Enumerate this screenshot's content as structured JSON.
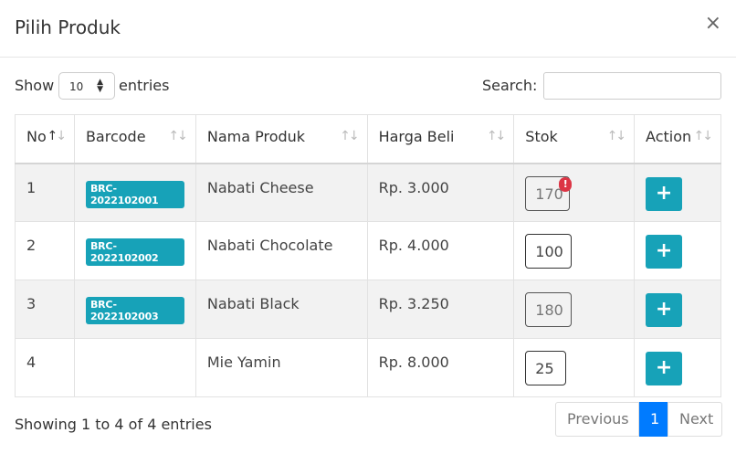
{
  "modal": {
    "title": "Pilih Produk",
    "close_glyph": "×"
  },
  "controls": {
    "show_label": "Show",
    "entries_value": "10",
    "entries_label": "entries",
    "search_label": "Search:",
    "search_value": ""
  },
  "table": {
    "headers": [
      "No",
      "Barcode",
      "Nama Produk",
      "Harga Beli",
      "Stok",
      "Action"
    ],
    "rows": [
      {
        "no": "1",
        "barcode": "BRC-2022102001",
        "nama": "Nabati Cheese",
        "harga": "Rp. 3.000",
        "stok": "170",
        "warning": "!",
        "action": "+"
      },
      {
        "no": "2",
        "barcode": "BRC-2022102002",
        "nama": "Nabati Chocolate",
        "harga": "Rp. 4.000",
        "stok": "100",
        "action": "+"
      },
      {
        "no": "3",
        "barcode": "BRC-2022102003",
        "nama": "Nabati Black",
        "harga": "Rp. 3.250",
        "stok": "180",
        "action": "+"
      },
      {
        "no": "4",
        "barcode": "",
        "nama": "Mie Yamin",
        "harga": "Rp. 8.000",
        "stok": "25",
        "action": "+"
      }
    ]
  },
  "footer": {
    "info": "Showing 1 to 4 of 4 entries",
    "previous": "Previous",
    "current_page": "1",
    "next": "Next"
  },
  "colors": {
    "accent": "#17a2b8",
    "primary": "#007bff",
    "warning": "#dc3545"
  }
}
